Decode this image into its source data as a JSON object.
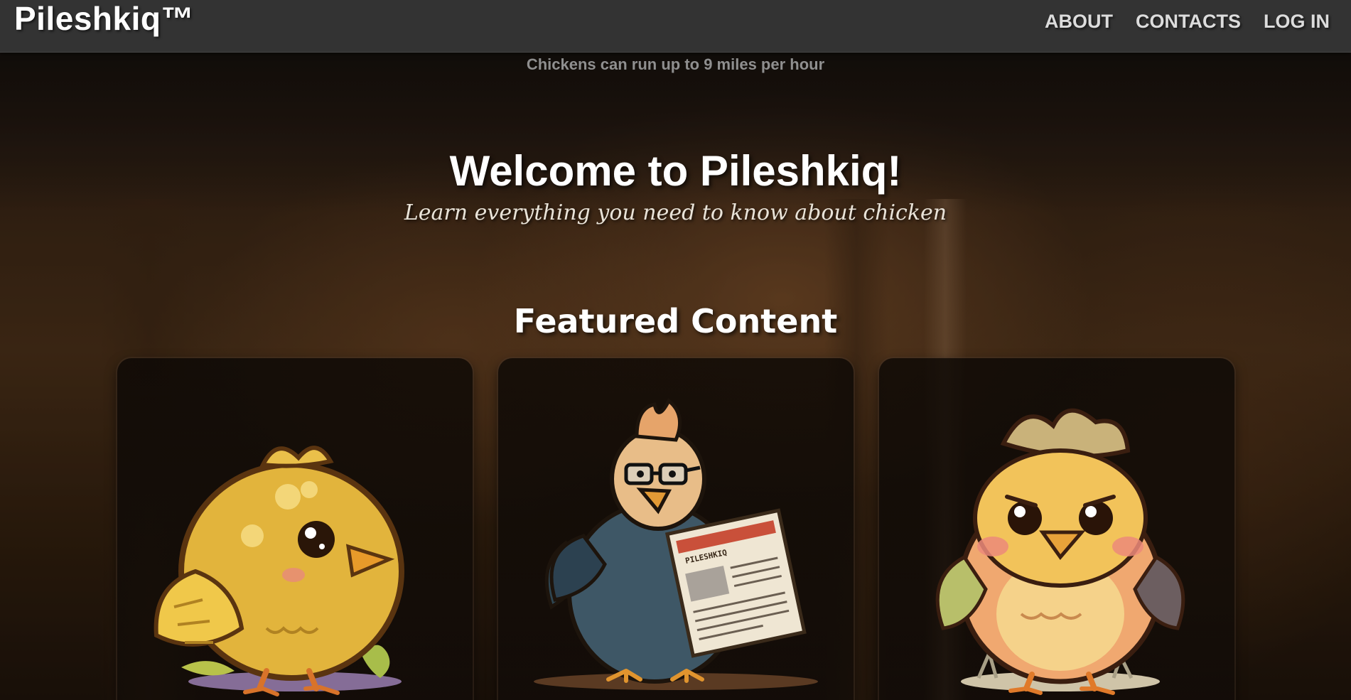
{
  "navbar": {
    "brand": "Pileshkiq™",
    "links": [
      {
        "label": "ABOUT"
      },
      {
        "label": "CONTACTS"
      },
      {
        "label": "LOG IN"
      }
    ]
  },
  "fact_banner": "Chickens can run up to 9 miles per hour",
  "hero": {
    "title": "Welcome to Pileshkiq!",
    "subtitle": "Learn everything you need to know about chicken"
  },
  "featured": {
    "title": "Featured Content",
    "cards": [
      {
        "image": "yellow-chick-illustration"
      },
      {
        "image": "chicken-reading-newspaper-illustration",
        "newspaper_text": "PILESHKIQ"
      },
      {
        "image": "colorful-chick-illustration"
      }
    ]
  },
  "colors": {
    "navbar_bg": "#333333",
    "nav_text": "#dcdcdc",
    "fact_text": "#8f8f8f",
    "title_text": "#ffffff"
  }
}
